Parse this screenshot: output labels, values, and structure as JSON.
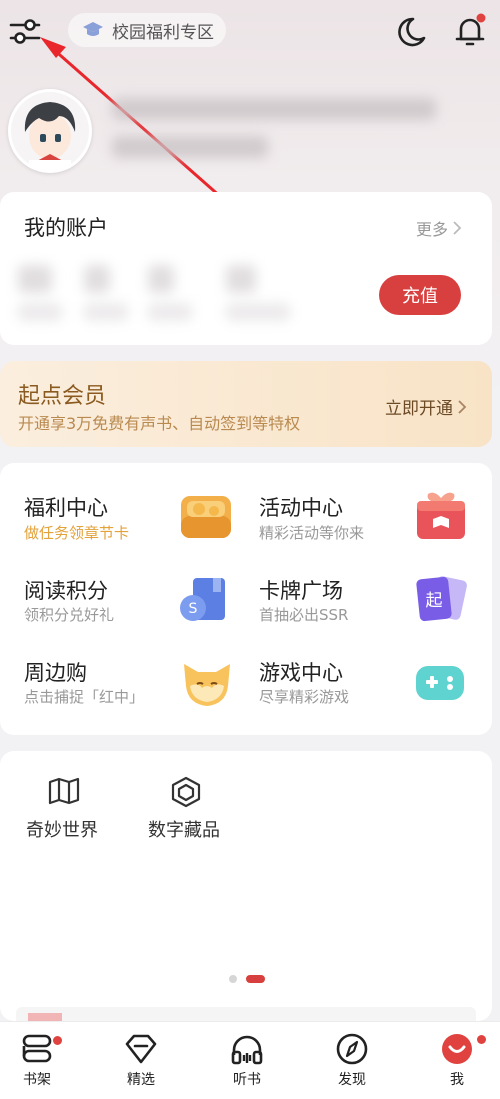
{
  "header": {
    "campus_label": "校园福利专区"
  },
  "account": {
    "title": "我的账户",
    "more": "更多",
    "recharge": "充值"
  },
  "vip": {
    "title": "起点会员",
    "subtitle": "开通享3万免费有声书、自动签到等特权",
    "open": "立即开通"
  },
  "welfare": {
    "items": [
      {
        "title": "福利中心",
        "subtitle": "做任务领章节卡",
        "icon": "coin-chest-icon"
      },
      {
        "title": "活动中心",
        "subtitle": "精彩活动等你来",
        "icon": "gift-box-icon"
      },
      {
        "title": "阅读积分",
        "subtitle": "领积分兑好礼",
        "icon": "points-book-icon"
      },
      {
        "title": "卡牌广场",
        "subtitle": "首抽必出SSR",
        "icon": "cards-icon"
      },
      {
        "title": "周边购",
        "subtitle": "点击捕捉「红中」",
        "icon": "fox-mascot-icon"
      },
      {
        "title": "游戏中心",
        "subtitle": "尽享精彩游戏",
        "icon": "gamepad-icon"
      }
    ],
    "card_icon_text": "起"
  },
  "world": {
    "items": [
      {
        "label": "奇妙世界",
        "icon": "map-icon"
      },
      {
        "label": "数字藏品",
        "icon": "cube-icon"
      }
    ]
  },
  "nav": {
    "items": [
      {
        "label": "书架",
        "icon": "bookshelf-icon"
      },
      {
        "label": "精选",
        "icon": "diamond-icon"
      },
      {
        "label": "听书",
        "icon": "headphones-icon"
      },
      {
        "label": "发现",
        "icon": "compass-icon"
      },
      {
        "label": "我",
        "icon": "me-face-icon"
      }
    ]
  },
  "colors": {
    "accent_red": "#d83f3f",
    "vip_gold": "#8a5a20",
    "welfare_accent": "#e3a23a"
  }
}
